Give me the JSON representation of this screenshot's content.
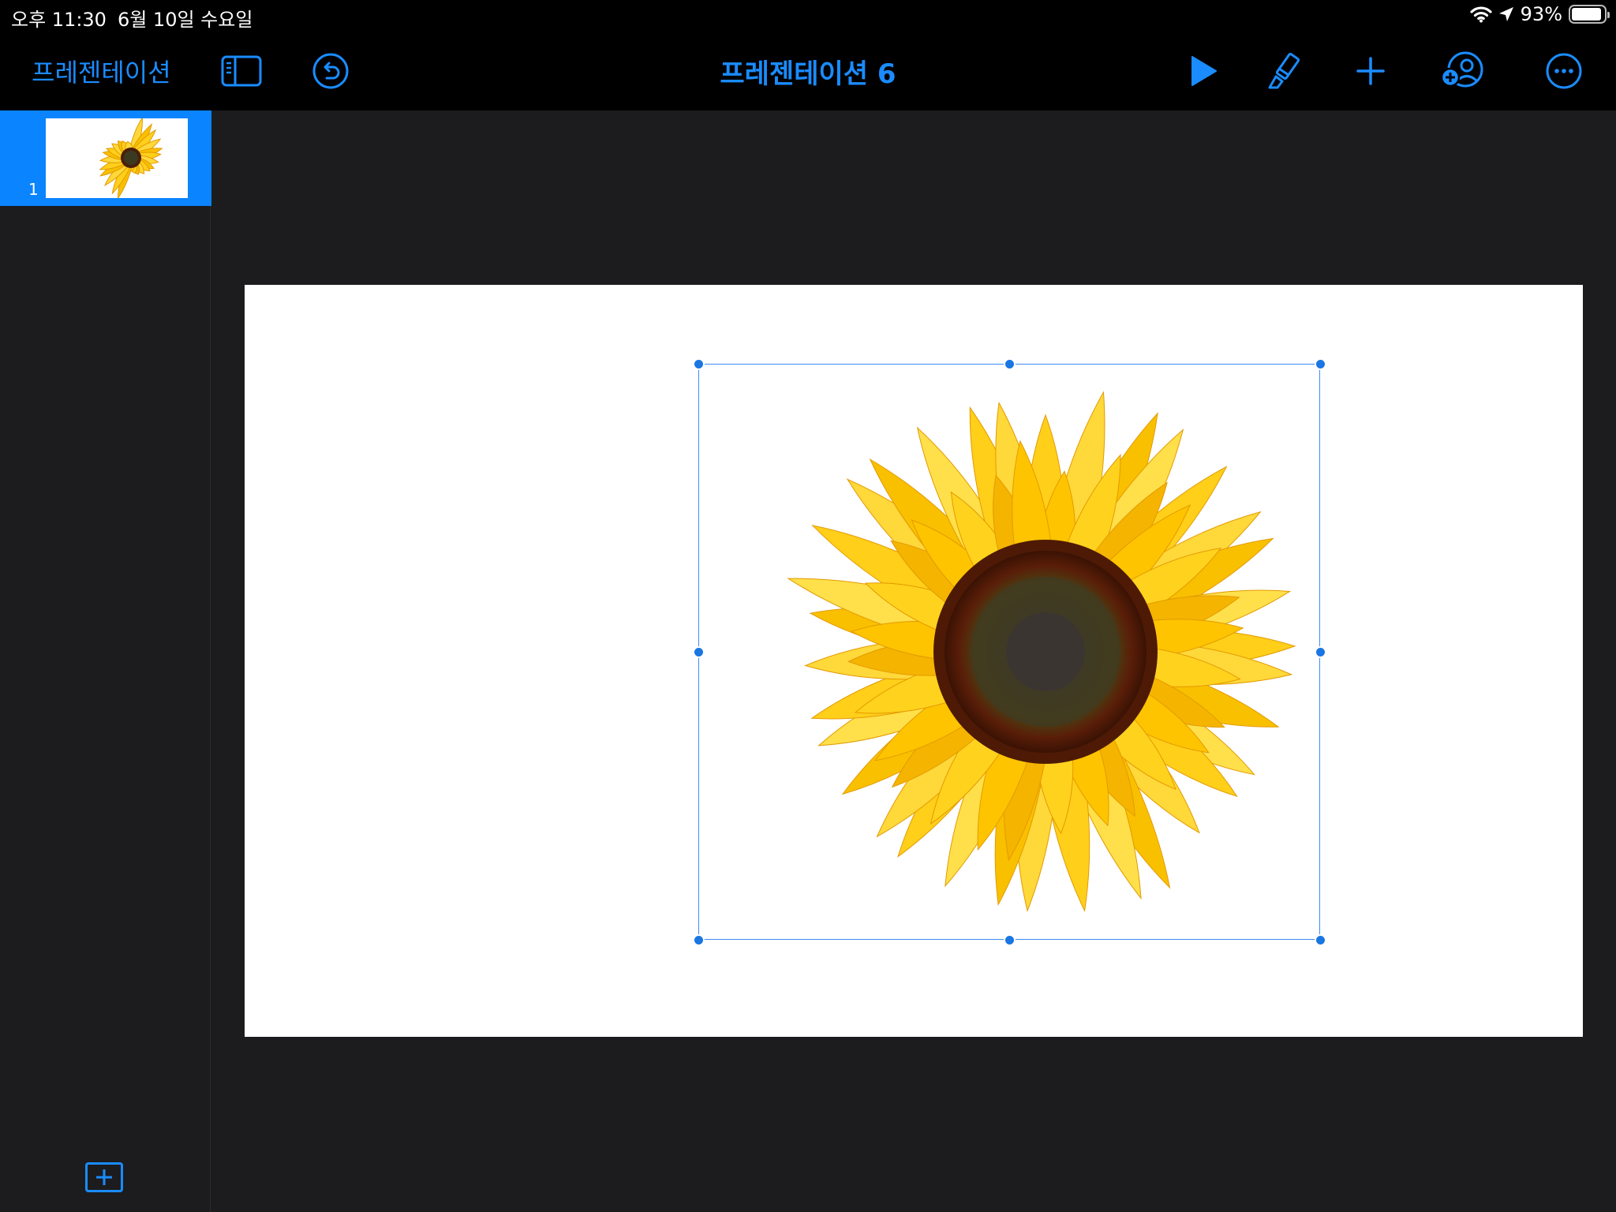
{
  "status_bar": {
    "time": "오후 11:30",
    "date": "6월 10일 수요일",
    "battery_percent": "93%",
    "battery_level": 0.93
  },
  "toolbar": {
    "back_label": "프레젠테이션",
    "document_title": "프레젠테이션 6",
    "icons": [
      "sidebar-toggle-icon",
      "undo-icon",
      "play-icon",
      "paintbrush-icon",
      "plus-icon",
      "collaborate-icon",
      "more-icon"
    ]
  },
  "slides": [
    {
      "number": "1",
      "selected": true
    }
  ],
  "canvas": {
    "selected_object": "sunflower-image"
  },
  "colors": {
    "accent": "#1a8cff",
    "selection": "#1976e3",
    "background": "#1c1c1e"
  }
}
